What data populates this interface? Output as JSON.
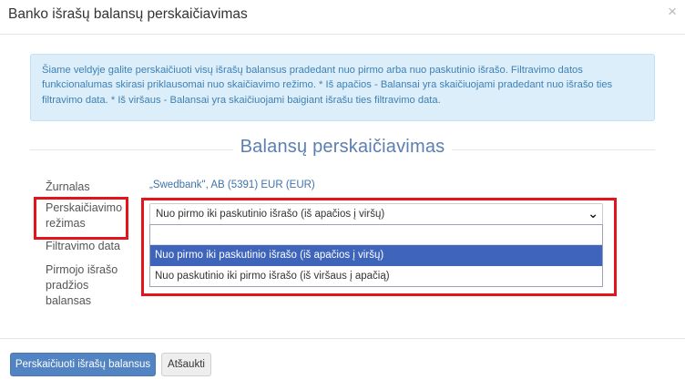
{
  "modal": {
    "title": "Banko išrašų balansų perskaičiavimas",
    "close_glyph": "×"
  },
  "info": {
    "text": "Šiame veldyje galite perskaičiuoti visų išrašų balansus pradedant nuo pirmo arba nuo paskutinio išrašo. Filtravimo datos funkcionalumas skirasi priklausomai nuo skaičiavimo režimo. * Iš apačios - Balansai yra skaičiuojami pradedant nuo išrašo ties filtravimo data. * Iš viršaus - Balansai yra skaičiuojami baigiant išrašu ties filtravimo data."
  },
  "section": {
    "heading": "Balansų perskaičiavimas"
  },
  "form": {
    "journal_label": "Žurnalas",
    "journal_value": "„Swedbank\", AB (5391) EUR (EUR)",
    "mode_label_line1": "Perskaičiavimo",
    "mode_label_line2": "režimas",
    "mode_selected": "Nuo pirmo iki paskutinio išrašo (iš apačios į viršų)",
    "chevron_icon": "chevron-down-icon",
    "filter_date_label": "Filtravimo data",
    "first_balance_label_line1": "Pirmojo išrašo",
    "first_balance_label_line2": "pradžios",
    "first_balance_label_line3": "balansas"
  },
  "dropdown": {
    "options": [
      {
        "label": "Nuo pirmo iki paskutinio išrašo (iš apačios į viršų)",
        "selected": true
      },
      {
        "label": "Nuo paskutinio iki pirmo išrašo (iš viršaus į apačią)",
        "selected": false
      }
    ]
  },
  "footer": {
    "primary_button": "Perskaičiuoti išrašų balansus",
    "cancel_button": "Atšaukti"
  },
  "colors": {
    "highlight": "#e3141c",
    "primary": "#5284c3",
    "selected_option": "#3e64bc",
    "info_bg": "#dceefa",
    "heading": "#5a7fb0"
  }
}
